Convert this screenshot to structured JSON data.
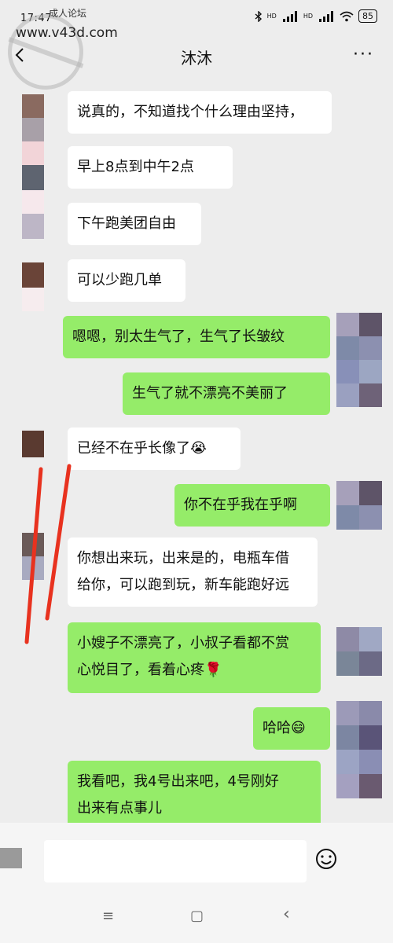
{
  "status_bar": {
    "time": "17:47",
    "battery": "85",
    "signal_label_1": "HD",
    "signal_label_2": "HD"
  },
  "watermark": {
    "site_name": "成人论坛",
    "url": "www.v43d.com"
  },
  "header": {
    "title": "沐沐",
    "more": "···"
  },
  "messages": [
    {
      "from": "other",
      "text": "说真的，不知道找个什么理由坚持，"
    },
    {
      "from": "other",
      "text": "早上8点到中午2点"
    },
    {
      "from": "other",
      "text": "下午跑美团自由"
    },
    {
      "from": "other",
      "text": "可以少跑几单"
    },
    {
      "from": "me",
      "text": "嗯嗯，别太生气了，生气了长皱纹"
    },
    {
      "from": "me",
      "text": "生气了就不漂亮不美丽了"
    },
    {
      "from": "other",
      "text": "已经不在乎长像了😭"
    },
    {
      "from": "me",
      "text": "你不在乎我在乎啊"
    },
    {
      "from": "other",
      "line1": "你想出来玩，出来是的，电瓶车借",
      "line2": "给你，可以跑到玩，新车能跑好远"
    },
    {
      "from": "me",
      "line1": "小嫂子不漂亮了，小叔子看都不赏",
      "line2": "心悦目了，看着心疼🌹"
    },
    {
      "from": "me",
      "text": "哈哈😄"
    },
    {
      "from": "me",
      "line1": "我看吧，我4号出来吧，4号刚好",
      "line2": "出来有点事儿"
    }
  ],
  "colors": {
    "my_bubble": "#95ec69",
    "their_bubble": "#ffffff",
    "background": "#ededed",
    "red_mark": "#e8321f"
  },
  "system_nav": {
    "menu": "≡",
    "home": "▢",
    "back": "‹"
  },
  "icons": {
    "back": "back-arrow-icon",
    "more": "more-icon",
    "emoji": "emoji-icon",
    "bluetooth": "bluetooth-icon",
    "wifi": "wifi-icon"
  }
}
